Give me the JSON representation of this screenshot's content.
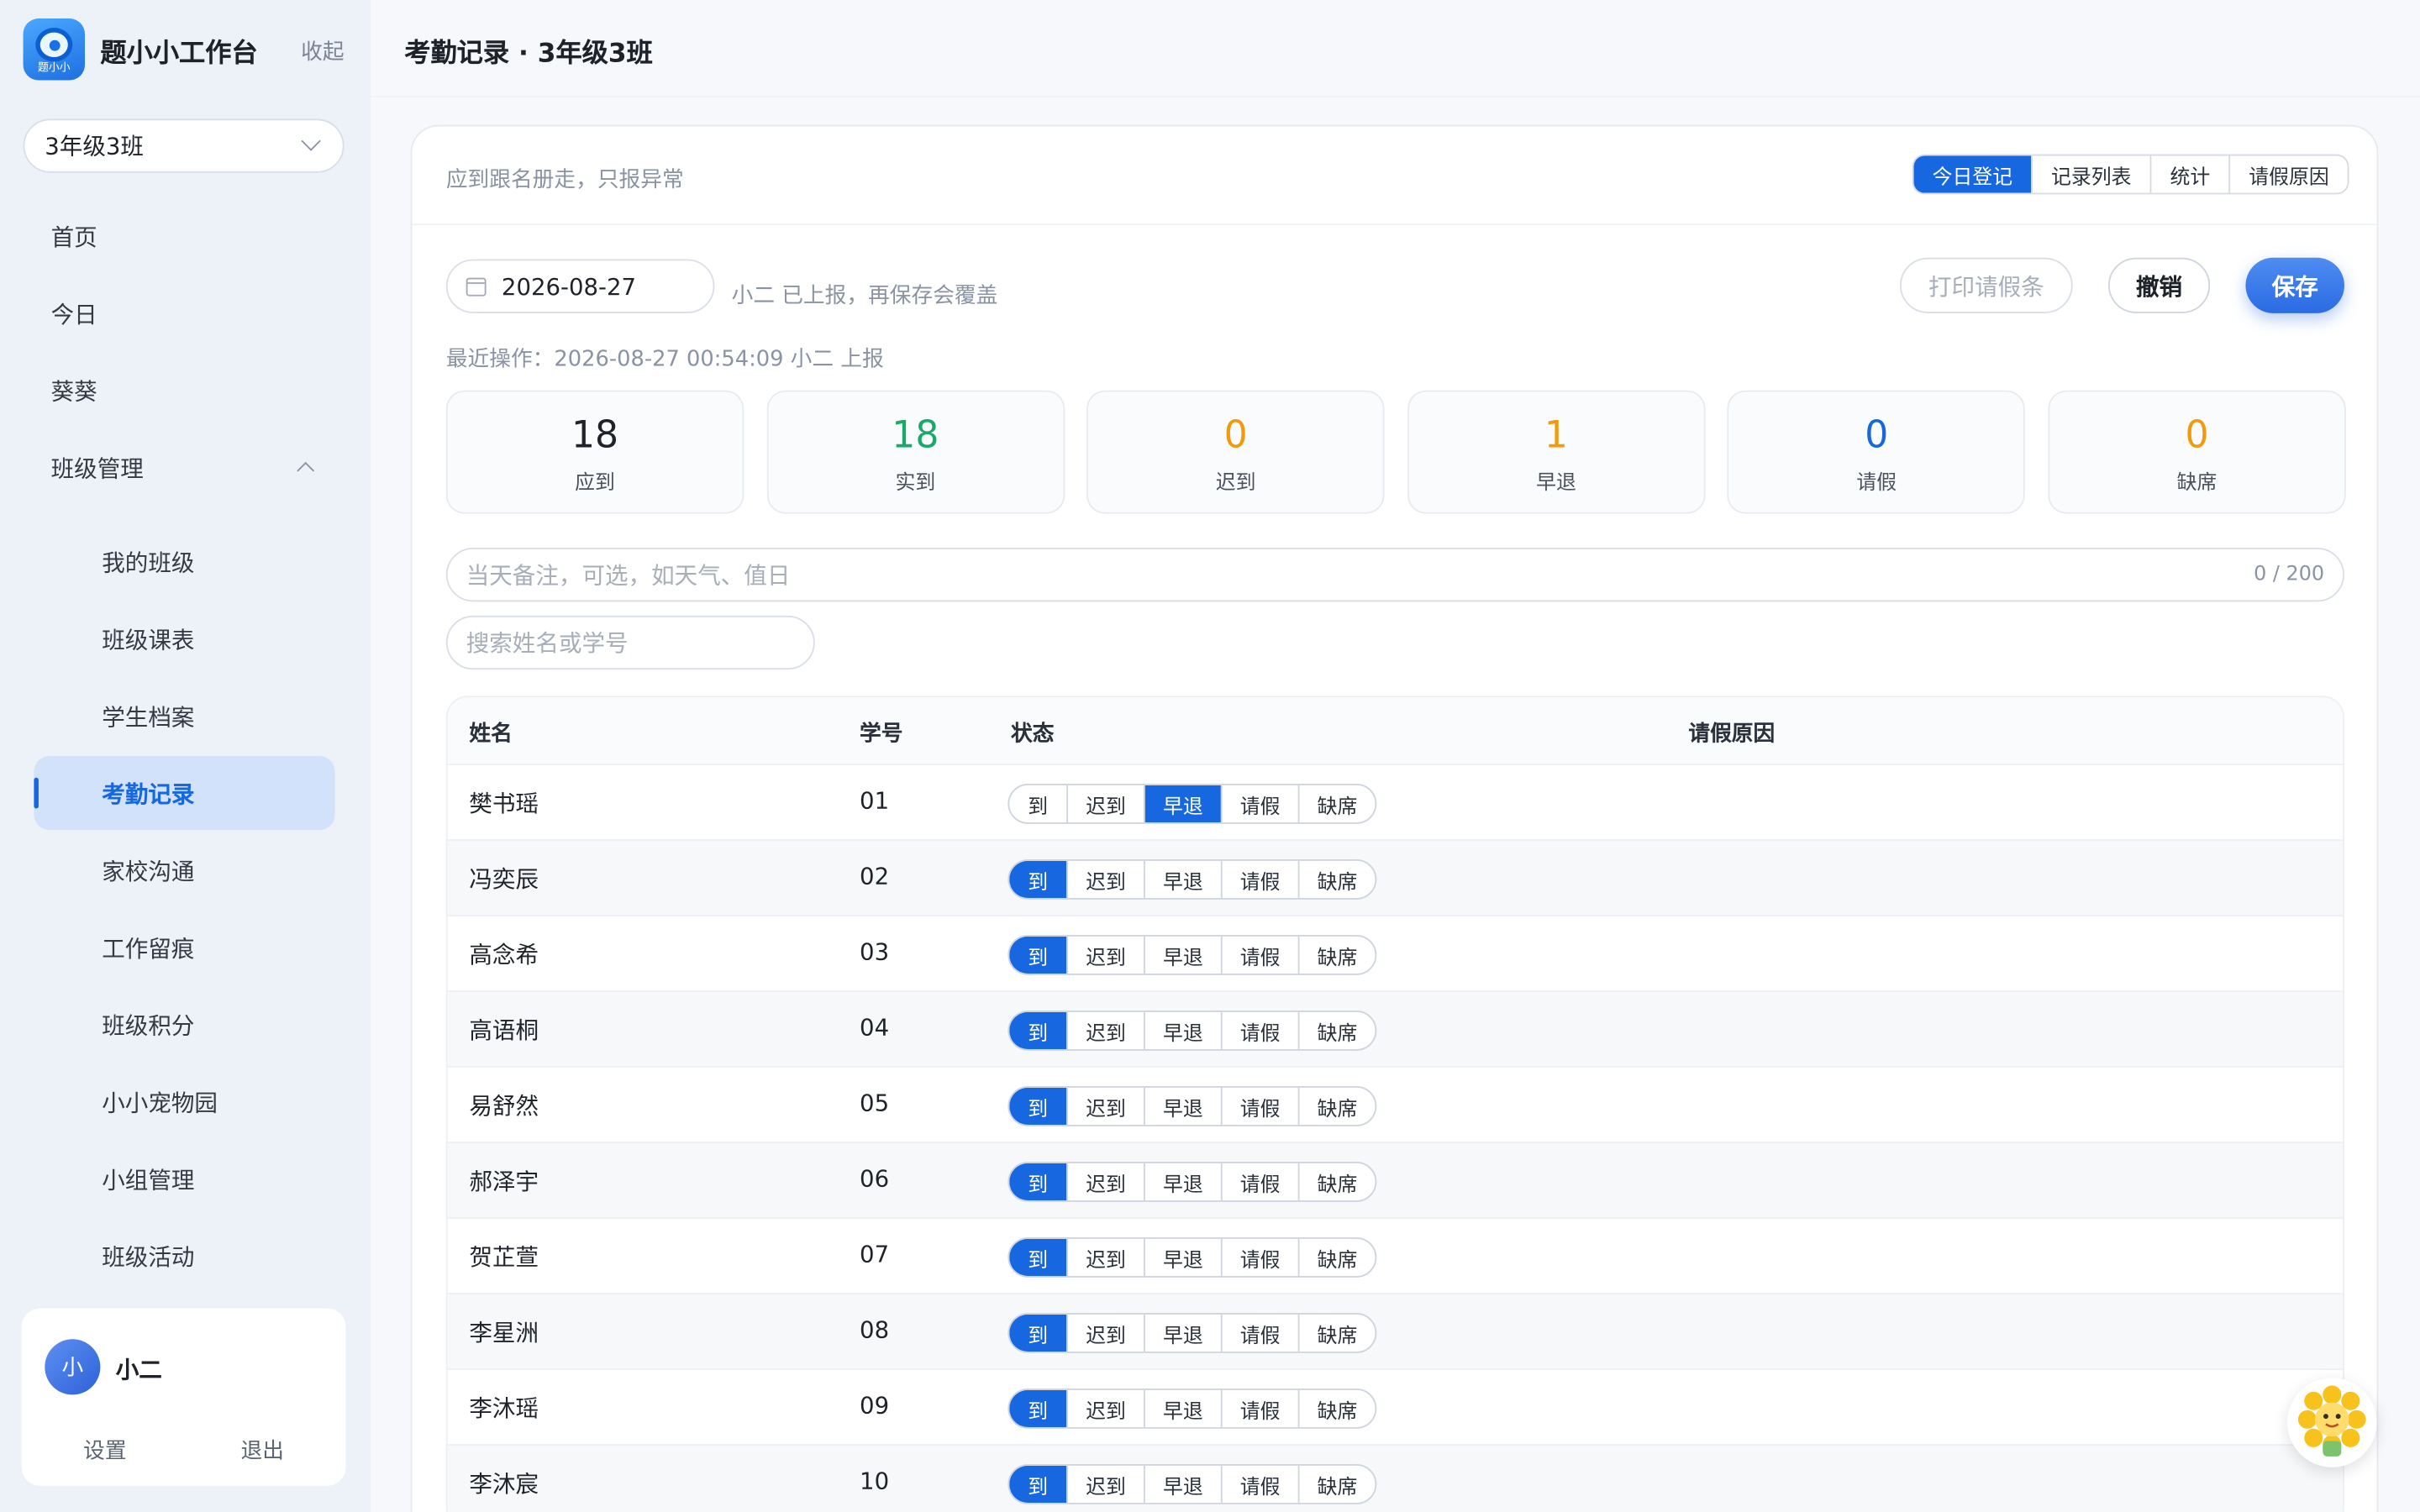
{
  "app": {
    "name": "题小小工作台",
    "collapse_label": "收起",
    "logo_text": "题小小"
  },
  "class_select": {
    "value": "3年级3班"
  },
  "nav": [
    {
      "label": "首页"
    },
    {
      "label": "今日"
    },
    {
      "label": "葵葵"
    },
    {
      "label": "班级管理"
    }
  ],
  "subnav": [
    {
      "label": "我的班级"
    },
    {
      "label": "班级课表"
    },
    {
      "label": "学生档案"
    },
    {
      "label": "考勤记录"
    },
    {
      "label": "家校沟通"
    },
    {
      "label": "工作留痕"
    },
    {
      "label": "班级积分"
    },
    {
      "label": "小小宠物园"
    },
    {
      "label": "小组管理"
    },
    {
      "label": "班级活动"
    }
  ],
  "user": {
    "avatar_text": "小",
    "name": "小二",
    "settings_label": "设置",
    "logout_label": "退出"
  },
  "page": {
    "title": "考勤记录 · 3年级3班"
  },
  "card": {
    "hint": "应到跟名册走，只报异常"
  },
  "view_tabs": [
    {
      "label": "今日登记",
      "active": true
    },
    {
      "label": "记录列表",
      "active": false
    },
    {
      "label": "统计",
      "active": false
    },
    {
      "label": "请假原因",
      "active": false
    }
  ],
  "toolbar": {
    "date": "2026-08-27",
    "report_note": "小二 已上报，再保存会覆盖",
    "print_label": "打印请假条",
    "undo_label": "撤销",
    "save_label": "保存",
    "last_op": "最近操作：2026-08-27 00:54:09 小二 上报"
  },
  "stats": [
    {
      "value": "18",
      "label": "应到",
      "color": "#1f2329"
    },
    {
      "value": "18",
      "label": "实到",
      "color": "#1aa86b"
    },
    {
      "value": "0",
      "label": "迟到",
      "color": "#f29a0c"
    },
    {
      "value": "1",
      "label": "早退",
      "color": "#f29a0c"
    },
    {
      "value": "0",
      "label": "请假",
      "color": "#1768e0"
    },
    {
      "value": "0",
      "label": "缺席",
      "color": "#f29a0c"
    }
  ],
  "remark": {
    "placeholder": "当天备注，可选，如天气、值日",
    "count": "0 / 200"
  },
  "search": {
    "placeholder": "搜索姓名或学号"
  },
  "table": {
    "headers": {
      "name": "姓名",
      "id": "学号",
      "status": "状态",
      "reason": "请假原因"
    },
    "status_options": [
      "到",
      "迟到",
      "早退",
      "请假",
      "缺席"
    ],
    "rows": [
      {
        "name": "樊书瑶",
        "id": "01",
        "status": "早退",
        "reason": ""
      },
      {
        "name": "冯奕辰",
        "id": "02",
        "status": "到",
        "reason": ""
      },
      {
        "name": "高念希",
        "id": "03",
        "status": "到",
        "reason": ""
      },
      {
        "name": "高语桐",
        "id": "04",
        "status": "到",
        "reason": ""
      },
      {
        "name": "易舒然",
        "id": "05",
        "status": "到",
        "reason": ""
      },
      {
        "name": "郝泽宇",
        "id": "06",
        "status": "到",
        "reason": ""
      },
      {
        "name": "贺芷萱",
        "id": "07",
        "status": "到",
        "reason": ""
      },
      {
        "name": "李星洲",
        "id": "08",
        "status": "到",
        "reason": ""
      },
      {
        "name": "李沐瑶",
        "id": "09",
        "status": "到",
        "reason": ""
      },
      {
        "name": "李沐宸",
        "id": "10",
        "status": "到",
        "reason": ""
      }
    ]
  },
  "colors": {
    "accent": "#1768e0",
    "sidebar_bg": "#edf1f8",
    "active_item_bg": "#d3e2fb"
  },
  "icons": [
    "app-logo-icon",
    "chevron-down-icon",
    "chevron-up-icon",
    "calendar-icon",
    "sunflower-mascot-icon"
  ]
}
